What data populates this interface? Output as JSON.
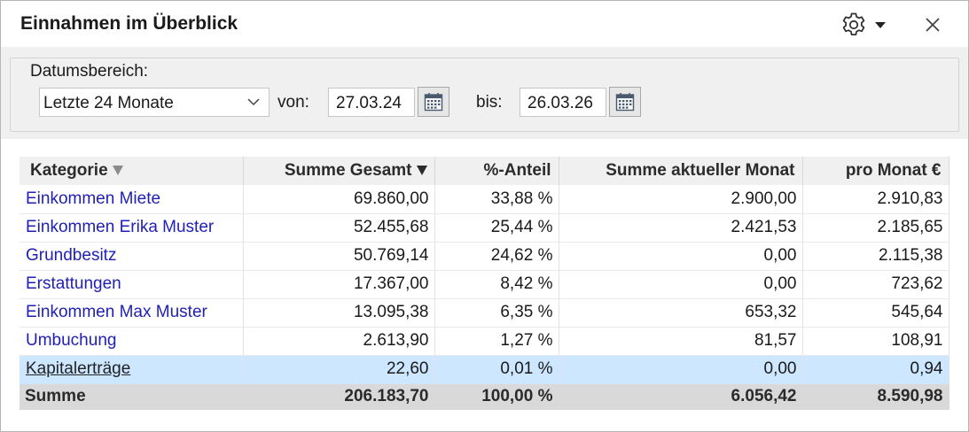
{
  "window": {
    "title": "Einnahmen im Überblick",
    "settings_icon": "gear-icon",
    "close_icon": "close-icon"
  },
  "filter": {
    "group_label": "Datumsbereich:",
    "range_selected": "Letzte 24 Monate",
    "from_label": "von:",
    "from_value": "27.03.24",
    "to_label": "bis:",
    "to_value": "26.03.26",
    "calendar_icon": "calendar-icon"
  },
  "table": {
    "headers": {
      "category": "Kategorie",
      "total": "Summe Gesamt",
      "share": "%-Anteil",
      "current_month": "Summe aktueller Monat",
      "per_month": "pro Monat €"
    },
    "rows": [
      {
        "category": "Einkommen Miete",
        "total": "69.860,00",
        "share": "33,88 %",
        "current_month": "2.900,00",
        "per_month": "2.910,83"
      },
      {
        "category": "Einkommen Erika Muster",
        "total": "52.455,68",
        "share": "25,44 %",
        "current_month": "2.421,53",
        "per_month": "2.185,65"
      },
      {
        "category": "Grundbesitz",
        "total": "50.769,14",
        "share": "24,62 %",
        "current_month": "0,00",
        "per_month": "2.115,38"
      },
      {
        "category": "Erstattungen",
        "total": "17.367,00",
        "share": "8,42 %",
        "current_month": "0,00",
        "per_month": "723,62"
      },
      {
        "category": "Einkommen Max Muster",
        "total": "13.095,38",
        "share": "6,35 %",
        "current_month": "653,32",
        "per_month": "545,64"
      },
      {
        "category": "Umbuchung",
        "total": "2.613,90",
        "share": "1,27 %",
        "current_month": "81,57",
        "per_month": "108,91"
      },
      {
        "category": "Kapitalerträge",
        "total": "22,60",
        "share": "0,01 %",
        "current_month": "0,00",
        "per_month": "0,94"
      }
    ],
    "selected_row": 6,
    "totals": {
      "label": "Summe",
      "total": "206.183,70",
      "share": "100,00 %",
      "current_month": "6.056,42",
      "per_month": "8.590,98"
    }
  },
  "colors": {
    "link": "#1f1fb4",
    "selected_row": "#cce7ff",
    "header_bg": "#f0f0f0",
    "total_bg": "#d9d9d9"
  }
}
